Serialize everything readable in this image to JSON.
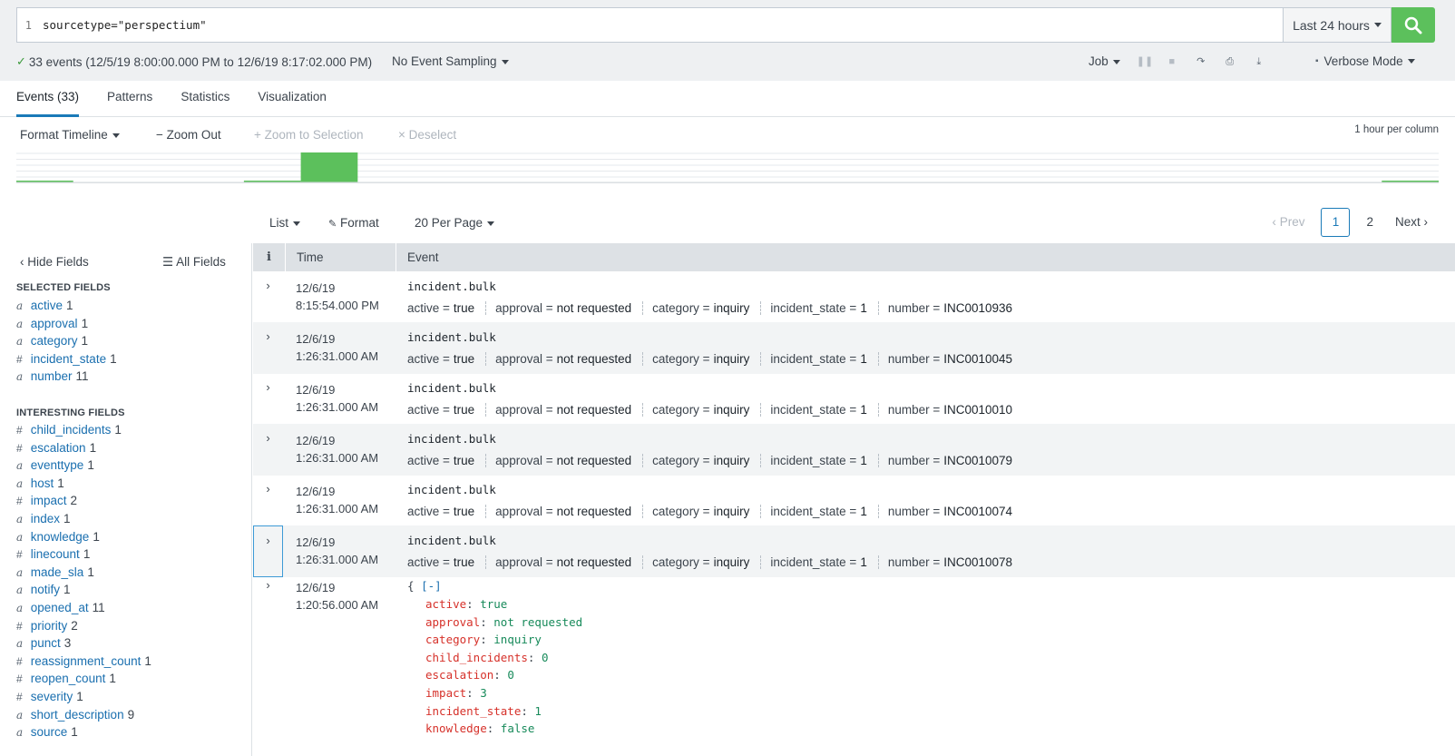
{
  "search": {
    "line_number": "1",
    "query": "sourcetype=\"perspectium\"",
    "time_range": "Last 24 hours"
  },
  "status": {
    "summary": "33 events (12/5/19 8:00:00.000 PM to 12/6/19 8:17:02.000 PM)",
    "sampling": "No Event Sampling",
    "job": "Job",
    "mode": "Verbose Mode"
  },
  "tabs": [
    "Events (33)",
    "Patterns",
    "Statistics",
    "Visualization"
  ],
  "timeline": {
    "format": "Format Timeline",
    "zoom_out": "Zoom Out",
    "zoom_selection": "Zoom to Selection",
    "deselect": "Deselect",
    "scale": "1 hour per column",
    "bars": [
      0.03,
      0,
      0,
      0,
      0.03,
      1.0,
      0,
      0,
      0,
      0,
      0,
      0,
      0,
      0,
      0,
      0,
      0,
      0,
      0,
      0,
      0,
      0,
      0,
      0,
      0.03
    ],
    "color": "#5cc05c"
  },
  "results_toolbar": {
    "list": "List",
    "format": "Format",
    "per_page": "20 Per Page",
    "prev": "Prev",
    "pages": [
      "1",
      "2"
    ],
    "next": "Next"
  },
  "sidebar": {
    "hide_fields": "Hide Fields",
    "all_fields": "All Fields",
    "selected_title": "SELECTED FIELDS",
    "selected": [
      {
        "type": "a",
        "name": "active",
        "count": "1"
      },
      {
        "type": "a",
        "name": "approval",
        "count": "1"
      },
      {
        "type": "a",
        "name": "category",
        "count": "1"
      },
      {
        "type": "#",
        "name": "incident_state",
        "count": "1"
      },
      {
        "type": "a",
        "name": "number",
        "count": "11"
      }
    ],
    "interesting_title": "INTERESTING FIELDS",
    "interesting": [
      {
        "type": "#",
        "name": "child_incidents",
        "count": "1"
      },
      {
        "type": "#",
        "name": "escalation",
        "count": "1"
      },
      {
        "type": "a",
        "name": "eventtype",
        "count": "1"
      },
      {
        "type": "a",
        "name": "host",
        "count": "1"
      },
      {
        "type": "#",
        "name": "impact",
        "count": "2"
      },
      {
        "type": "a",
        "name": "index",
        "count": "1"
      },
      {
        "type": "a",
        "name": "knowledge",
        "count": "1"
      },
      {
        "type": "#",
        "name": "linecount",
        "count": "1"
      },
      {
        "type": "a",
        "name": "made_sla",
        "count": "1"
      },
      {
        "type": "a",
        "name": "notify",
        "count": "1"
      },
      {
        "type": "a",
        "name": "opened_at",
        "count": "11"
      },
      {
        "type": "#",
        "name": "priority",
        "count": "2"
      },
      {
        "type": "a",
        "name": "punct",
        "count": "3"
      },
      {
        "type": "#",
        "name": "reassignment_count",
        "count": "1"
      },
      {
        "type": "#",
        "name": "reopen_count",
        "count": "1"
      },
      {
        "type": "#",
        "name": "severity",
        "count": "1"
      },
      {
        "type": "a",
        "name": "short_description",
        "count": "9"
      },
      {
        "type": "a",
        "name": "source",
        "count": "1"
      }
    ]
  },
  "events_header": {
    "info": "i",
    "time": "Time",
    "event": "Event"
  },
  "events": [
    {
      "date": "12/6/19",
      "time": "8:15:54.000 PM",
      "raw": "incident.bulk",
      "number": "INC0010936"
    },
    {
      "date": "12/6/19",
      "time": "1:26:31.000 AM",
      "raw": "incident.bulk",
      "number": "INC0010045"
    },
    {
      "date": "12/6/19",
      "time": "1:26:31.000 AM",
      "raw": "incident.bulk",
      "number": "INC0010010"
    },
    {
      "date": "12/6/19",
      "time": "1:26:31.000 AM",
      "raw": "incident.bulk",
      "number": "INC0010079"
    },
    {
      "date": "12/6/19",
      "time": "1:26:31.000 AM",
      "raw": "incident.bulk",
      "number": "INC0010074"
    },
    {
      "date": "12/6/19",
      "time": "1:26:31.000 AM",
      "raw": "incident.bulk",
      "number": "INC0010078"
    }
  ],
  "event_field_labels": {
    "active": "active =",
    "active_val": "true",
    "approval": "approval =",
    "approval_val": "not requested",
    "category": "category =",
    "category_val": "inquiry",
    "incident_state": "incident_state =",
    "incident_state_val": "1",
    "number": "number ="
  },
  "json_event": {
    "date": "12/6/19",
    "time": "1:20:56.000 AM",
    "open": "{",
    "collapse": "[-]",
    "lines": [
      {
        "key": "active",
        "value": "true"
      },
      {
        "key": "approval",
        "value": "not requested"
      },
      {
        "key": "category",
        "value": "inquiry"
      },
      {
        "key": "child_incidents",
        "value": "0"
      },
      {
        "key": "escalation",
        "value": "0"
      },
      {
        "key": "impact",
        "value": "3"
      },
      {
        "key": "incident_state",
        "value": "1"
      },
      {
        "key": "knowledge",
        "value": "false"
      }
    ]
  }
}
